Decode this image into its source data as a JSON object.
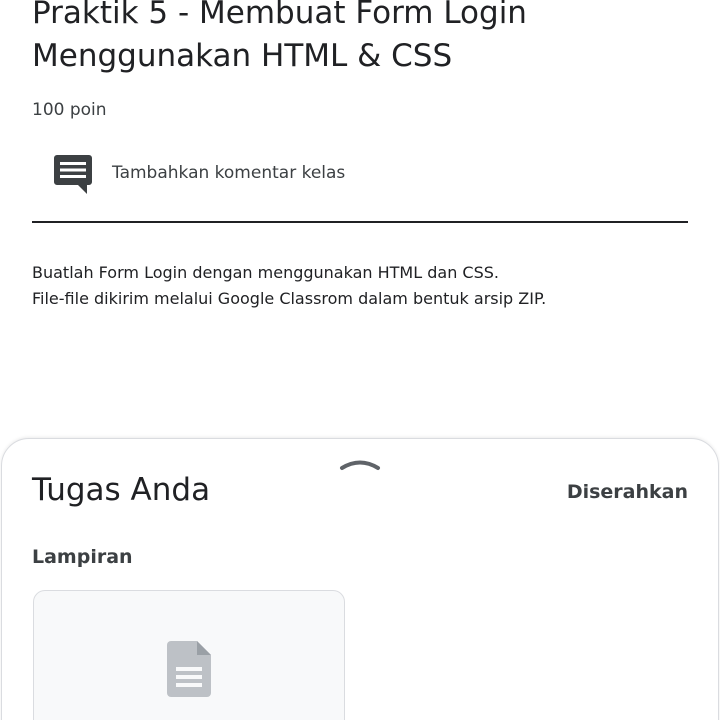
{
  "assignment": {
    "title": "Praktik 5 - Membuat Form Login Menggunakan HTML & CSS",
    "points": "100 poin",
    "class_comment_label": "Tambahkan komentar kelas",
    "description_lines": [
      "Buatlah Form Login dengan menggunakan HTML dan CSS.",
      "File-file dikirim melalui Google Classrom dalam bentuk arsip ZIP."
    ]
  },
  "your_work": {
    "title": "Tugas Anda",
    "status": "Diserahkan",
    "attachments_label": "Lampiran",
    "attachment_icon": "document-icon"
  },
  "icons": {
    "comment": "comment-icon",
    "handle": "chevron-up-icon"
  },
  "colors": {
    "text_primary": "#202124",
    "text_secondary": "#3c4043",
    "border": "#dadce0",
    "icon_gray": "#bdc1c6"
  }
}
